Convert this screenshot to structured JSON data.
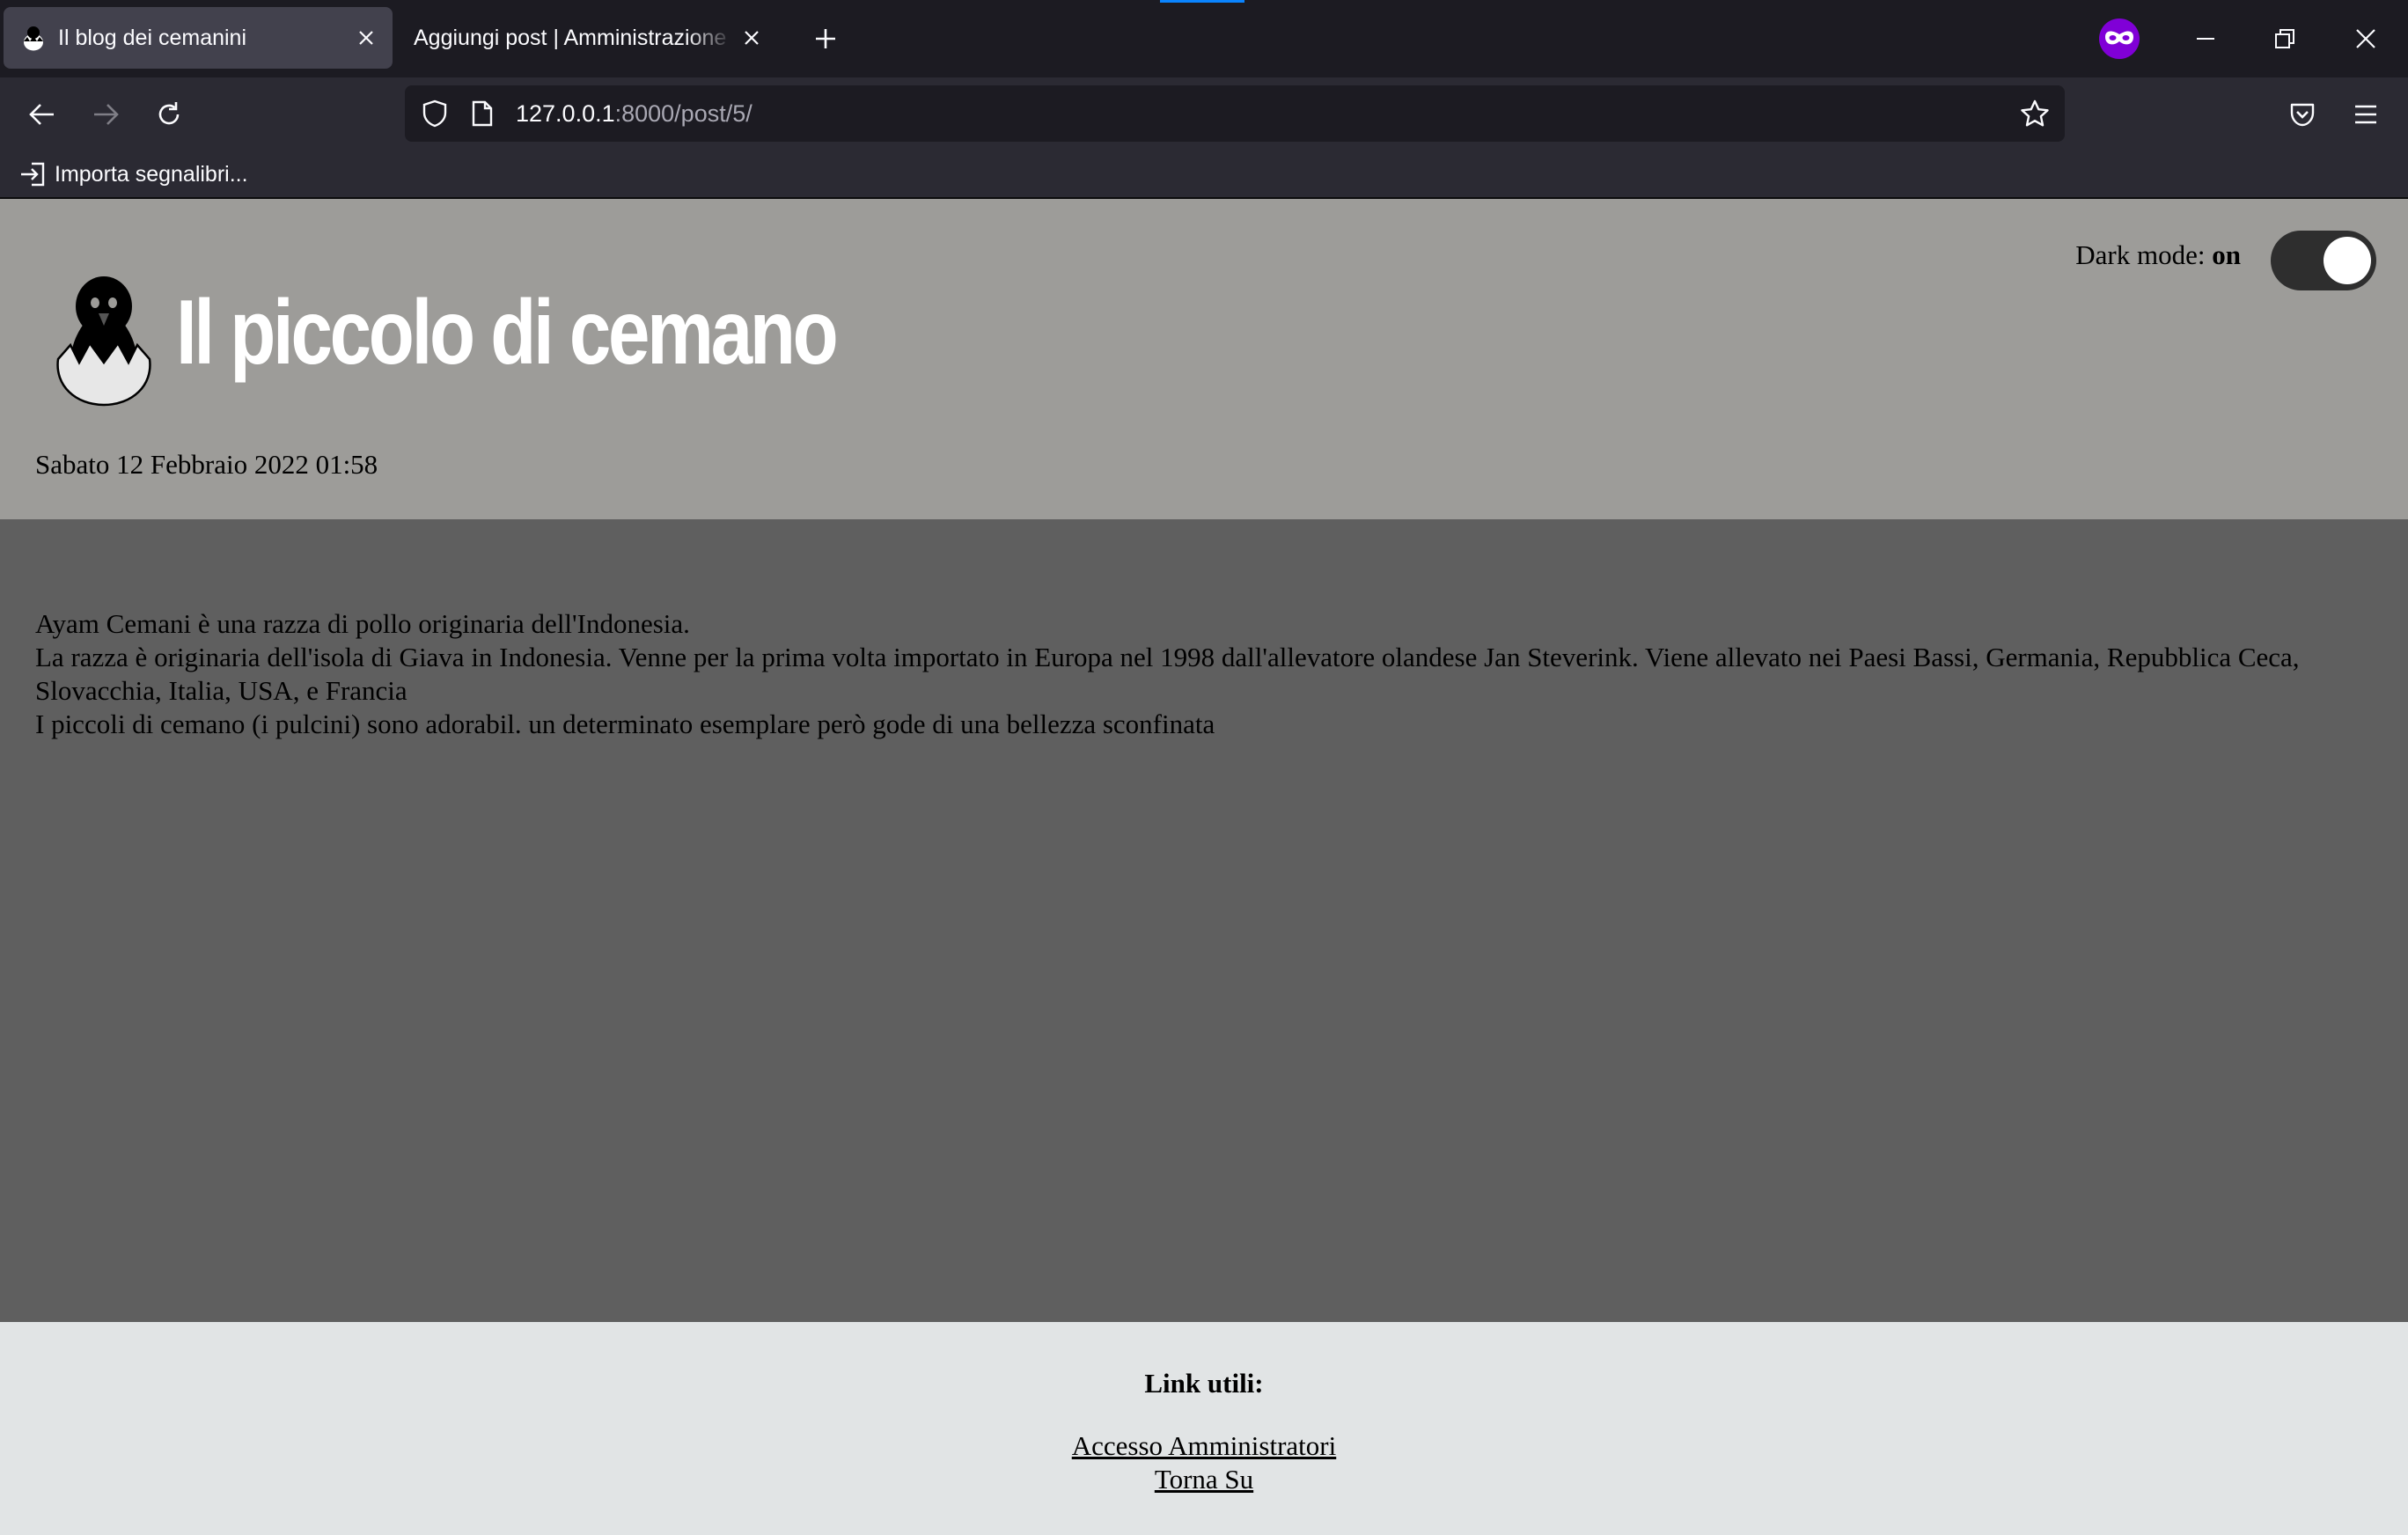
{
  "browser": {
    "tabs": [
      {
        "title": "Il blog dei cemanini",
        "active": true
      },
      {
        "title": "Aggiungi post | Amministrazione sito Django",
        "active": false
      }
    ],
    "url": {
      "host": "127.0.0.1",
      "rest": ":8000/post/5/"
    },
    "bookmarks": [
      {
        "label": "Importa segnalibri..."
      }
    ]
  },
  "header": {
    "title": "Il piccolo di cemano",
    "date": "Sabato 12 Febbraio 2022 01:58",
    "dark_mode": {
      "label": "Dark mode:",
      "state": "on"
    }
  },
  "post": {
    "paragraphs": [
      "Ayam Cemani è una razza di pollo originaria dell'Indonesia.",
      "La razza è originaria dell'isola di Giava in Indonesia. Venne per la prima volta importato in Europa nel 1998 dall'allevatore olandese Jan Steverink. Viene allevato nei Paesi Bassi, Germania, Repubblica Ceca, Slovacchia, Italia, USA, e Francia",
      "I piccoli di cemano (i pulcini) sono adorabil. un determinato esemplare però gode di una bellezza sconfinata"
    ]
  },
  "footer": {
    "title": "Link utili:",
    "links": [
      {
        "label": "Accesso Amministratori"
      },
      {
        "label": "Torna Su"
      }
    ]
  },
  "colors": {
    "header_bg": "#9d9c99",
    "content_bg": "#5f5f5f",
    "footer_bg": "#e1e4e5",
    "toggle_bg": "#2e2e2e",
    "browser_dark": "#1c1b22",
    "browser_toolbar": "#2b2a33",
    "private_purple": "#8000d7"
  },
  "icons": {
    "tab_favicon": "chick-icon",
    "tab_close": "close-icon",
    "new_tab": "plus-icon",
    "private": "private-browsing-mask-icon",
    "back": "arrow-left-icon",
    "forward": "arrow-right-icon",
    "reload": "reload-icon",
    "shield": "shield-icon",
    "page": "page-icon",
    "bookmark": "star-icon",
    "pocket": "pocket-icon",
    "menu": "hamburger-menu-icon",
    "import": "import-icon",
    "logo": "chick-in-egg-logo"
  }
}
